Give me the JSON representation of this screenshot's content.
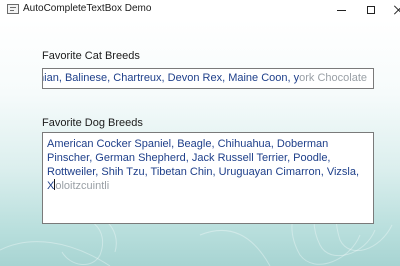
{
  "window": {
    "title": "AutoCompleteTextBox Demo",
    "controls": {
      "minimize_icon": "minimize-icon",
      "maximize_icon": "maximize-icon",
      "close_icon": "close-icon"
    }
  },
  "cat_field": {
    "label": "Favorite Cat Breeds",
    "typed_text": "yssinian, Balinese, Chartreux, Devon Rex, Maine Coon, y",
    "suggestion_text": "ork Chocolate"
  },
  "dog_field": {
    "label": "Favorite Dog Breeds",
    "typed_text": "American Cocker Spaniel, Beagle, Chihuahua, Doberman Pinscher, German Shepherd, Jack Russell Terrier, Poodle, Rottweiler, Shih Tzu, Tibetan Chin, Uruguayan Cimarron, Vizsla, X",
    "suggestion_text": "oloitzcuintli"
  },
  "colors": {
    "typed_text": "#1e3f8a",
    "suggestion_text": "#9aa0a6",
    "background_top": "#ffffff",
    "background_bottom": "#a7d4d2"
  }
}
